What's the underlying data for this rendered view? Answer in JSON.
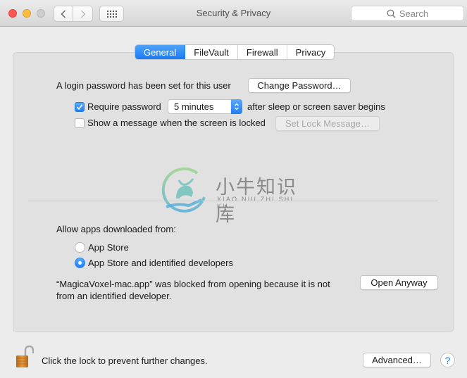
{
  "window": {
    "title": "Security & Privacy",
    "search_placeholder": "Search"
  },
  "tabs": [
    {
      "label": "General",
      "active": true
    },
    {
      "label": "FileVault",
      "active": false
    },
    {
      "label": "Firewall",
      "active": false
    },
    {
      "label": "Privacy",
      "active": false
    }
  ],
  "general": {
    "login_password_text": "A login password has been set for this user",
    "change_password_label": "Change Password…",
    "require_password": {
      "checked": true,
      "label": "Require password",
      "delay_value": "5 minutes",
      "suffix": "after sleep or screen saver begins"
    },
    "show_message": {
      "checked": false,
      "label": "Show a message when the screen is locked",
      "button_label": "Set Lock Message…",
      "button_enabled": false
    }
  },
  "watermark": {
    "chinese": "小牛知识库",
    "latin": "XIAO NIU ZHI SHI KU"
  },
  "downloads": {
    "heading": "Allow apps downloaded from:",
    "options": [
      {
        "label": "App Store",
        "selected": false
      },
      {
        "label": "App Store and identified developers",
        "selected": true
      }
    ],
    "blocked_line1": "“MagicaVoxel-mac.app” was blocked from opening because it is not",
    "blocked_line2": "from an identified developer.",
    "open_anyway_label": "Open Anyway"
  },
  "footer": {
    "lock_text": "Click the lock to prevent further changes.",
    "lock_state": "unlocked",
    "advanced_label": "Advanced…",
    "help_label": "?"
  },
  "colors": {
    "accent": "#1f7ff5",
    "lock": "#d4892e"
  }
}
